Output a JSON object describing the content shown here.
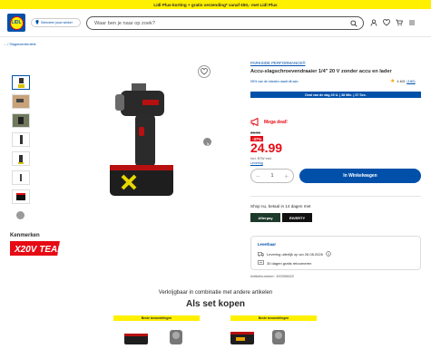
{
  "banner": {
    "text": "Lidl Plus-korting + gratis verzending* vanaf €50,- met Lidl Plus"
  },
  "header": {
    "logo_text": "LIDL",
    "store_selector": "Selecteer jouw winkel",
    "search_placeholder": "Waar ben je naar op zoek?"
  },
  "breadcrumb": {
    "items": [
      "...",
      "/",
      "Slagmoersleutels"
    ]
  },
  "product": {
    "series_link": "PARKSIDE PERFORMANCE®",
    "title": "Accu-slagschroevendraaier 1/4\" 20 V zonder accu en lader",
    "shipping_note": "95% van de klanten raadt dit aan",
    "rating": "4.6/5",
    "rating_count": "(180)",
    "deal_bar": "Deal van de dag 23 U. | 38 Min. | 37 Sec.",
    "mega_deal": "Mega deal!",
    "old_price": "39.99",
    "discount": "-37%",
    "price": "24.99",
    "vat_line1": "Incl. BTW excl.",
    "vat_line2": "Levering",
    "quantity": "1",
    "qty_minus": "−",
    "qty_plus": "+",
    "cart_button": "In Winkelwagen",
    "pay_later": "Shop nu, betaal in 14 dagen met",
    "pay_logo_1": "Afterpay",
    "pay_logo_2": "RIVERTY",
    "delivery_title": "Leverbaar",
    "delivery_line": "Levering uiterlijk op wo 26.08.2026",
    "return_line": "30 dagen gratis retourneren",
    "article_number": "Artikelnummer: 100396622"
  },
  "brands": {
    "title": "Kenmerken",
    "logo_text": "X20V TEAM"
  },
  "combo": {
    "subtitle": "Verkrijgbaar in combinatie met andere artikelen",
    "title": "Als set kopen",
    "badge_1": "Beste beoordelingen",
    "badge_2": "Beste beoordelingen"
  },
  "colors": {
    "brand_blue": "#0050aa",
    "lidl_yellow": "#fff000",
    "deal_red": "#e60a14"
  },
  "icons": [
    "store-pin-icon",
    "search-icon",
    "user-icon",
    "favorites-icon",
    "cart-icon",
    "menu-icon",
    "heart-icon",
    "chevron-right-icon",
    "megaphone-icon",
    "info-icon",
    "truck-icon",
    "return-icon"
  ]
}
